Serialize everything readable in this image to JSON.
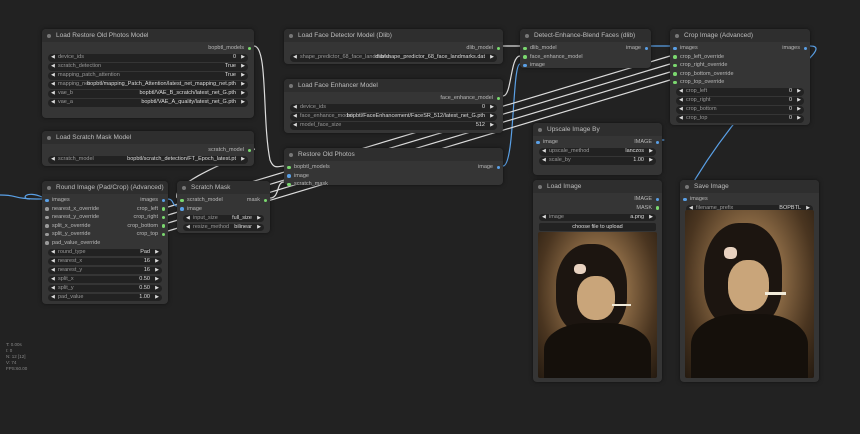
{
  "colors": {
    "canvas": "#222222",
    "node": "#353535",
    "image_slot": "#5aa0e6",
    "model_slot": "#7bd86f",
    "generic_slot": "#9a9a9a"
  },
  "nodes": {
    "load_restore_model": {
      "title": "Load Restore Old Photos Model",
      "inputs": [],
      "outputs": [
        {
          "label": "bopbtl_models",
          "type": "model"
        }
      ],
      "widgets": [
        {
          "label": "device_ids",
          "value": "0"
        },
        {
          "label": "scratch_detection",
          "value": "True"
        },
        {
          "label": "mapping_patch_attention",
          "value": "True"
        },
        {
          "label": "mapping_net",
          "value": "bopbtl/mapping_Patch_Attention/latest_net_mapping_net.pth"
        },
        {
          "label": "vae_b",
          "value": "bopbtl/VAE_B_scratch/latest_net_G.pth"
        },
        {
          "label": "vae_a",
          "value": "bopbtl/VAE_A_quality/latest_net_G.pth"
        }
      ]
    },
    "load_scratch_model": {
      "title": "Load Scratch Mask Model",
      "inputs": [],
      "outputs": [
        {
          "label": "scratch_model",
          "type": "model"
        }
      ],
      "widgets": [
        {
          "label": "scratch_model",
          "value": "bopbtl/scratch_detection/FT_Epoch_latest.pt"
        }
      ]
    },
    "round_image": {
      "title": "Round Image (Pad/Crop) (Advanced)",
      "inputs": [
        {
          "label": "images",
          "type": "image"
        },
        {
          "label": "nearest_x_override",
          "type": "generic"
        },
        {
          "label": "nearest_y_override",
          "type": "generic"
        },
        {
          "label": "split_x_override",
          "type": "generic"
        },
        {
          "label": "split_y_override",
          "type": "generic"
        },
        {
          "label": "pad_value_override",
          "type": "generic"
        }
      ],
      "outputs": [
        {
          "label": "images",
          "type": "image"
        },
        {
          "label": "crop_left",
          "type": "model"
        },
        {
          "label": "crop_right",
          "type": "model"
        },
        {
          "label": "crop_bottom",
          "type": "model"
        },
        {
          "label": "crop_top",
          "type": "model"
        }
      ],
      "widgets": [
        {
          "label": "round_type",
          "value": "Pad"
        },
        {
          "label": "nearest_x",
          "value": "16"
        },
        {
          "label": "nearest_y",
          "value": "16"
        },
        {
          "label": "split_x",
          "value": "0.50"
        },
        {
          "label": "split_y",
          "value": "0.50"
        },
        {
          "label": "pad_value",
          "value": "1.00"
        }
      ]
    },
    "scratch_mask": {
      "title": "Scratch Mask",
      "inputs": [
        {
          "label": "scratch_model",
          "type": "model"
        },
        {
          "label": "image",
          "type": "image"
        }
      ],
      "outputs": [
        {
          "label": "mask",
          "type": "model"
        }
      ],
      "widgets": [
        {
          "label": "input_size",
          "value": "full_size"
        },
        {
          "label": "resize_method",
          "value": "bilinear"
        }
      ]
    },
    "face_detector": {
      "title": "Load Face Detector Model (Dlib)",
      "inputs": [],
      "outputs": [
        {
          "label": "dlib_model",
          "type": "model"
        }
      ],
      "widgets": [
        {
          "label": "shape_predictor_68_face_landmarks",
          "value": "dlib/shape_predictor_68_face_landmarks.dat"
        }
      ]
    },
    "face_enhancer": {
      "title": "Load Face Enhancer Model",
      "inputs": [],
      "outputs": [
        {
          "label": "face_enhance_model",
          "type": "model"
        }
      ],
      "widgets": [
        {
          "label": "device_ids",
          "value": "0"
        },
        {
          "label": "face_enhance_model",
          "value": "bopbtl/FaceEnhancement/FaceSR_512/latest_net_G.pth"
        },
        {
          "label": "model_face_size",
          "value": "512"
        }
      ]
    },
    "restore_old_photos": {
      "title": "Restore Old Photos",
      "inputs": [
        {
          "label": "bopbtl_models",
          "type": "model"
        },
        {
          "label": "image",
          "type": "image"
        },
        {
          "label": "scratch_mask",
          "type": "model"
        }
      ],
      "outputs": [
        {
          "label": "image",
          "type": "image"
        }
      ],
      "widgets": []
    },
    "detect_enhance": {
      "title": "Detect-Enhance-Blend Faces (dlib)",
      "inputs": [
        {
          "label": "dlib_model",
          "type": "model"
        },
        {
          "label": "face_enhance_model",
          "type": "model"
        },
        {
          "label": "image",
          "type": "image"
        }
      ],
      "outputs": [
        {
          "label": "image",
          "type": "image"
        }
      ],
      "widgets": []
    },
    "crop_image": {
      "title": "Crop Image (Advanced)",
      "inputs": [
        {
          "label": "images",
          "type": "image"
        },
        {
          "label": "crop_left_override",
          "type": "model"
        },
        {
          "label": "crop_right_override",
          "type": "model"
        },
        {
          "label": "crop_bottom_override",
          "type": "model"
        },
        {
          "label": "crop_top_override",
          "type": "model"
        }
      ],
      "outputs": [
        {
          "label": "images",
          "type": "image"
        }
      ],
      "widgets": [
        {
          "label": "crop_left",
          "value": "0"
        },
        {
          "label": "crop_right",
          "value": "0"
        },
        {
          "label": "crop_bottom",
          "value": "0"
        },
        {
          "label": "crop_top",
          "value": "0"
        }
      ]
    },
    "upscale": {
      "title": "Upscale Image By",
      "inputs": [
        {
          "label": "image",
          "type": "image"
        }
      ],
      "outputs": [
        {
          "label": "IMAGE",
          "type": "image"
        }
      ],
      "widgets": [
        {
          "label": "upscale_method",
          "value": "lanczos"
        },
        {
          "label": "scale_by",
          "value": "1.00"
        }
      ]
    },
    "load_image": {
      "title": "Load Image",
      "inputs": [],
      "outputs": [
        {
          "label": "IMAGE",
          "type": "image"
        },
        {
          "label": "MASK",
          "type": "model"
        }
      ],
      "widgets": [
        {
          "label": "image",
          "value": "a.png"
        }
      ],
      "button": "choose file to upload",
      "photo": true
    },
    "save_image": {
      "title": "Save Image",
      "inputs": [
        {
          "label": "images",
          "type": "image"
        }
      ],
      "outputs": [],
      "widgets": [
        {
          "label": "filename_prefix",
          "value": "BOPBTL"
        }
      ],
      "photo": true
    }
  },
  "stats": [
    "T: 0.00s",
    "I: 0",
    "N: 12 [12]",
    "V: 74",
    "FPS:60.00"
  ]
}
